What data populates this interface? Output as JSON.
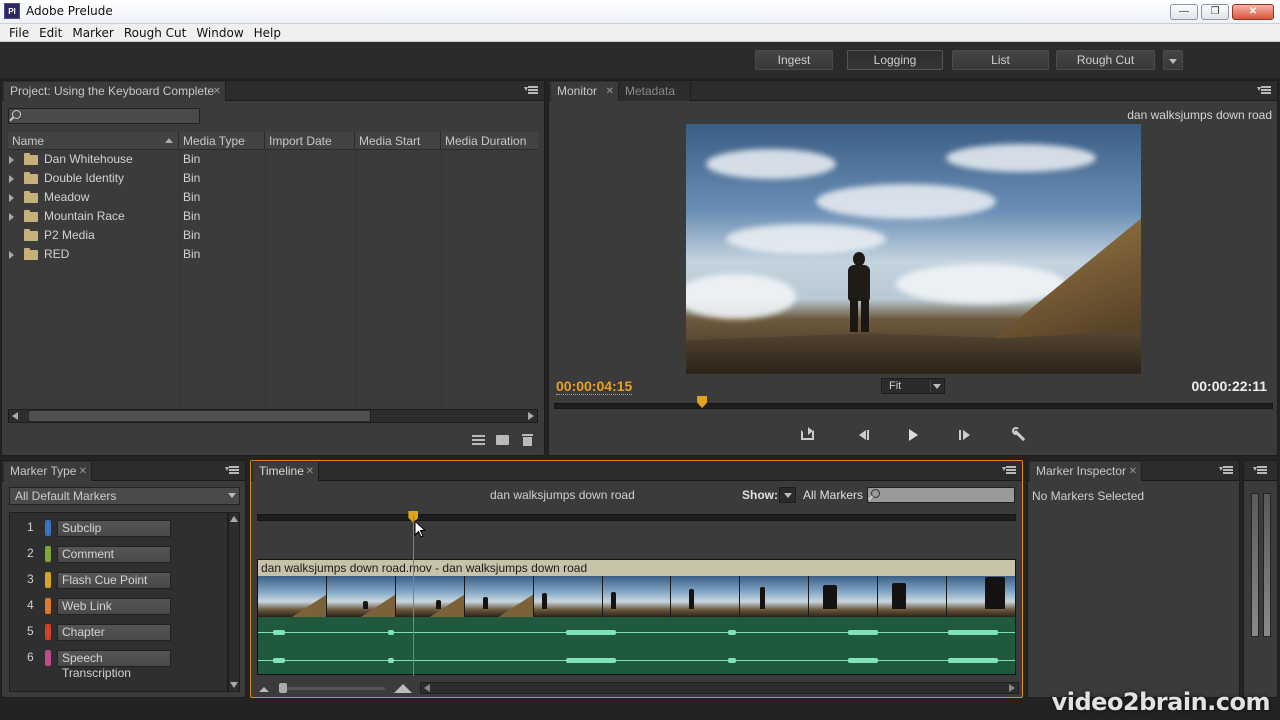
{
  "window": {
    "title": "Adobe Prelude",
    "icon_label": "Pl",
    "controls": [
      "minimize",
      "restore",
      "close"
    ]
  },
  "menu": [
    "File",
    "Edit",
    "Marker",
    "Rough Cut",
    "Window",
    "Help"
  ],
  "workspaces": {
    "items": [
      "Ingest",
      "Logging",
      "List",
      "Rough Cut"
    ],
    "active": "Logging"
  },
  "project": {
    "tab": "Project: Using the Keyboard Complete",
    "search_placeholder": "",
    "columns": [
      "Name",
      "Media Type",
      "Import Date",
      "Media Start",
      "Media Duration"
    ],
    "rows": [
      {
        "name": "Dan Whitehouse",
        "type": "Bin",
        "expandable": true
      },
      {
        "name": "Double Identity",
        "type": "Bin",
        "expandable": true
      },
      {
        "name": "Meadow",
        "type": "Bin",
        "expandable": true
      },
      {
        "name": "Mountain Race",
        "type": "Bin",
        "expandable": true
      },
      {
        "name": "P2 Media",
        "type": "Bin",
        "expandable": false
      },
      {
        "name": "RED",
        "type": "Bin",
        "expandable": true
      }
    ]
  },
  "monitor": {
    "tabs": [
      "Monitor",
      "Metadata"
    ],
    "clip_name": "dan walksjumps down road",
    "current_time": "00:00:04:15",
    "duration": "00:00:22:11",
    "zoom": "Fit",
    "playhead_fraction": 0.206,
    "controls": [
      "loop-icon",
      "step-back-icon",
      "play-icon",
      "step-forward-icon",
      "wrench-icon"
    ]
  },
  "marker_type": {
    "tab": "Marker Type",
    "filter": "All Default Markers",
    "items": [
      {
        "num": "1",
        "label": "Subclip",
        "color": "#3a72c8"
      },
      {
        "num": "2",
        "label": "Comment",
        "color": "#7ea83a"
      },
      {
        "num": "3",
        "label": "Flash Cue Point",
        "color": "#d8a428"
      },
      {
        "num": "4",
        "label": "Web Link",
        "color": "#e07a2a"
      },
      {
        "num": "5",
        "label": "Chapter",
        "color": "#d0402c"
      },
      {
        "num": "6",
        "label": "Speech Transcription",
        "color": "#c04a8c"
      }
    ]
  },
  "timeline": {
    "tab": "Timeline",
    "title": "dan walksjumps down road",
    "show_label": "Show:",
    "show_value": "All Markers",
    "clip_label": "dan walksjumps down road.mov - dan walksjumps down road",
    "playhead_fraction": 0.206
  },
  "marker_inspector": {
    "tab": "Marker Inspector",
    "status": "No Markers Selected"
  },
  "watermark": "video2brain.com",
  "colors": {
    "accent_orange": "#e8a020",
    "timecode_orange": "#e8a020",
    "audio_green": "#1f5a3f",
    "waveform": "#7fe3b5"
  }
}
